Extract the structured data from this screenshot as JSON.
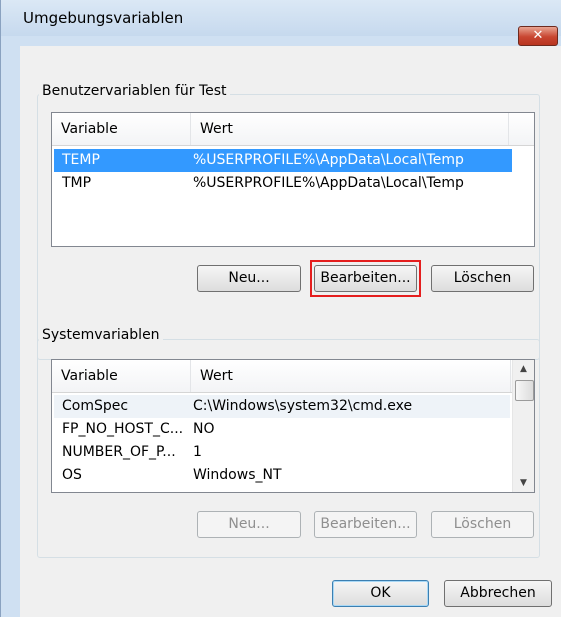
{
  "window": {
    "title": "Umgebungsvariablen",
    "close_symbol": "✕"
  },
  "user_group": {
    "legend": "Benutzervariablen für Test",
    "columns": [
      "Variable",
      "Wert"
    ],
    "rows": [
      {
        "variable": "TEMP",
        "wert": "%USERPROFILE%\\AppData\\Local\\Temp",
        "selected": true
      },
      {
        "variable": "TMP",
        "wert": "%USERPROFILE%\\AppData\\Local\\Temp",
        "selected": false
      }
    ],
    "buttons": {
      "new": "Neu...",
      "edit": "Bearbeiten...",
      "delete": "Löschen"
    }
  },
  "system_group": {
    "legend": "Systemvariablen",
    "columns": [
      "Variable",
      "Wert"
    ],
    "rows": [
      {
        "variable": "ComSpec",
        "wert": "C:\\Windows\\system32\\cmd.exe"
      },
      {
        "variable": "FP_NO_HOST_C...",
        "wert": "NO"
      },
      {
        "variable": "NUMBER_OF_P...",
        "wert": "1"
      },
      {
        "variable": "OS",
        "wert": "Windows_NT"
      }
    ],
    "buttons": {
      "new": "Neu...",
      "edit": "Bearbeiten...",
      "delete": "Löschen"
    }
  },
  "dialog_buttons": {
    "ok": "OK",
    "cancel": "Abbrechen"
  },
  "colors": {
    "selection": "#3399ff",
    "highlight_box": "#e51e1e"
  }
}
